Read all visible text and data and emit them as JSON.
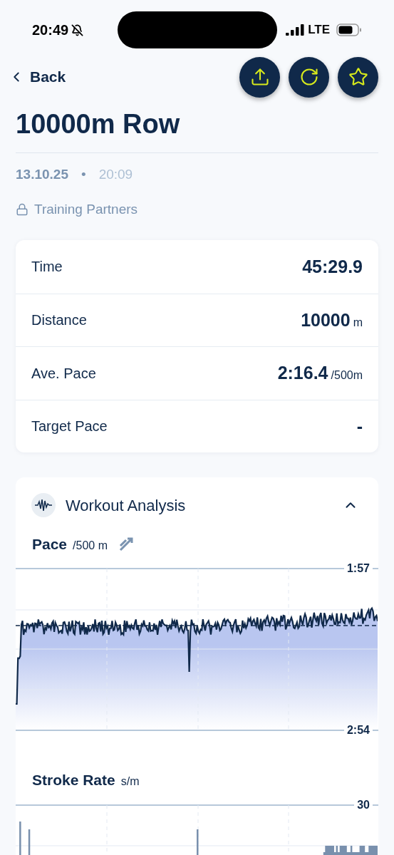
{
  "status_bar": {
    "time": "20:49",
    "network": "LTE"
  },
  "nav": {
    "back": "Back"
  },
  "title": "10000m Row",
  "date": "13.10.25",
  "separator": "•",
  "start_time": "20:09",
  "visibility": "Training Partners",
  "stats": [
    {
      "label": "Time",
      "value": "45:29.9"
    },
    {
      "label": "Distance",
      "value": "10000",
      "unit": "m"
    },
    {
      "label": "Ave. Pace",
      "value": "2:16.4",
      "unit": "/500m"
    },
    {
      "label": "Target Pace",
      "value": "-"
    }
  ],
  "analysis": {
    "title": "Workout Analysis",
    "expanded": true,
    "charts": [
      {
        "kind": "line",
        "title": "Pace",
        "unit": "/500 m",
        "top_tick": "1:57",
        "bottom_tick": "2:54"
      },
      {
        "kind": "bars",
        "title": "Stroke Rate",
        "unit": "s/m",
        "top_tick": "30"
      }
    ]
  }
}
